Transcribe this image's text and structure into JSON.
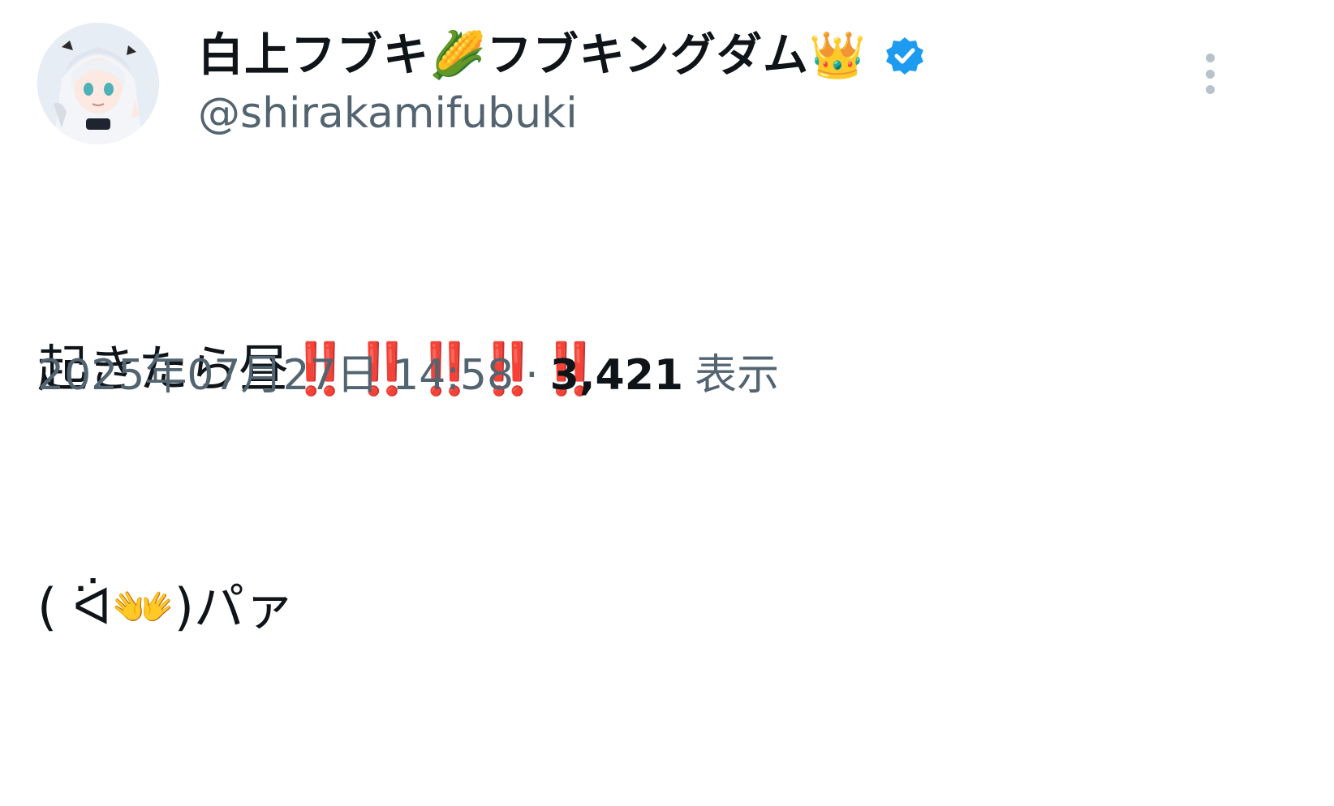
{
  "author": {
    "display_name": "白上フブキ🌽フブキングダム👑",
    "handle": "@shirakamifubuki",
    "verified_color": "#1d9bf0",
    "avatar_icon": "avatar-image"
  },
  "tweet": {
    "lines": [
      "起きたら昼‼️‼️‼️‼️‼️",
      "( ᐛ👐)パァ"
    ]
  },
  "meta": {
    "timestamp": "2025年07月27日 14:58",
    "separator": "·",
    "views_count": "3,421",
    "views_label": "表示"
  },
  "icons": {
    "more": "more-vertical-icon",
    "verified": "verified-badge-icon"
  }
}
